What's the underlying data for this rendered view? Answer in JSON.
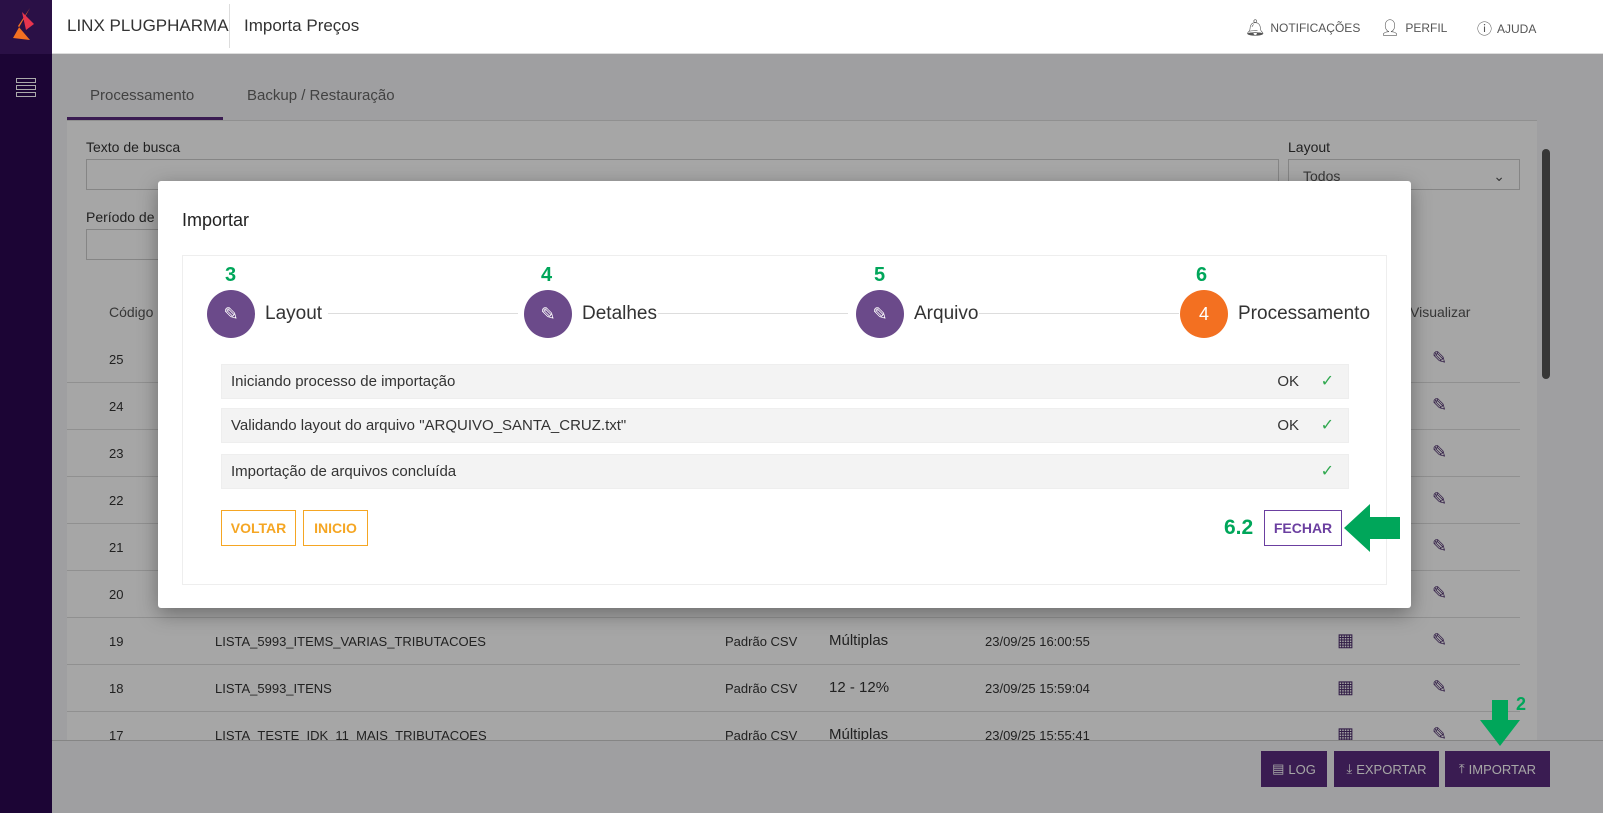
{
  "header": {
    "brand": "LINX PLUGPHARMA",
    "page_title": "Importa Preços",
    "notifications": "NOTIFICAÇÕES",
    "profile": "PERFIL",
    "help": "AJUDA"
  },
  "tabs": [
    "Processamento",
    "Backup / Restauração"
  ],
  "filters": {
    "search_label": "Texto de busca",
    "search_value": "",
    "period_label": "Período de",
    "layout_label": "Layout",
    "layout_value": "Todos"
  },
  "table": {
    "headers": {
      "code": "Código",
      "view": "Visualizar"
    },
    "rows": [
      {
        "code": "25"
      },
      {
        "code": "24"
      },
      {
        "code": "23"
      },
      {
        "code": "22"
      },
      {
        "code": "21"
      },
      {
        "code": "20"
      },
      {
        "code": "19",
        "name": "LISTA_5993_ITEMS_VARIAS_TRIBUTACOES",
        "layout": "Padrão CSV",
        "tax": "Múltiplas",
        "date": "23/09/25 16:00:55"
      },
      {
        "code": "18",
        "name": "LISTA_5993_ITENS",
        "layout": "Padrão CSV",
        "tax": "12 - 12%",
        "date": "23/09/25 15:59:04"
      },
      {
        "code": "17",
        "name": "LISTA_TESTE_IDK_11_MAIS_TRIBUTACOES",
        "layout": "Padrão CSV",
        "tax": "Múltiplas",
        "date": "23/09/25 15:55:41"
      }
    ]
  },
  "footer": {
    "log": "LOG",
    "export": "EXPORTAR",
    "import": "IMPORTAR"
  },
  "modal": {
    "title": "Importar",
    "steps": [
      {
        "label": "Layout",
        "annotation": "3"
      },
      {
        "label": "Detalhes",
        "annotation": "4"
      },
      {
        "label": "Arquivo",
        "annotation": "5"
      },
      {
        "label": "Processamento",
        "number": "4",
        "annotation": "6"
      }
    ],
    "status": [
      {
        "text": "Iniciando processo de importação",
        "result": "OK"
      },
      {
        "text": "Validando layout do arquivo \"ARQUIVO_SANTA_CRUZ.txt\"",
        "result": "OK"
      },
      {
        "text": "Importação de arquivos concluída",
        "result": ""
      }
    ],
    "back": "VOLTAR",
    "start": "INICIO",
    "close": "FECHAR",
    "close_annotation": "6.2"
  },
  "annotations": {
    "import": "2"
  },
  "colors": {
    "primary": "#5a2c7e",
    "step_done": "#6b4a8a",
    "step_active": "#f37021",
    "accent": "#f5a623",
    "annotation": "#00a65a"
  }
}
